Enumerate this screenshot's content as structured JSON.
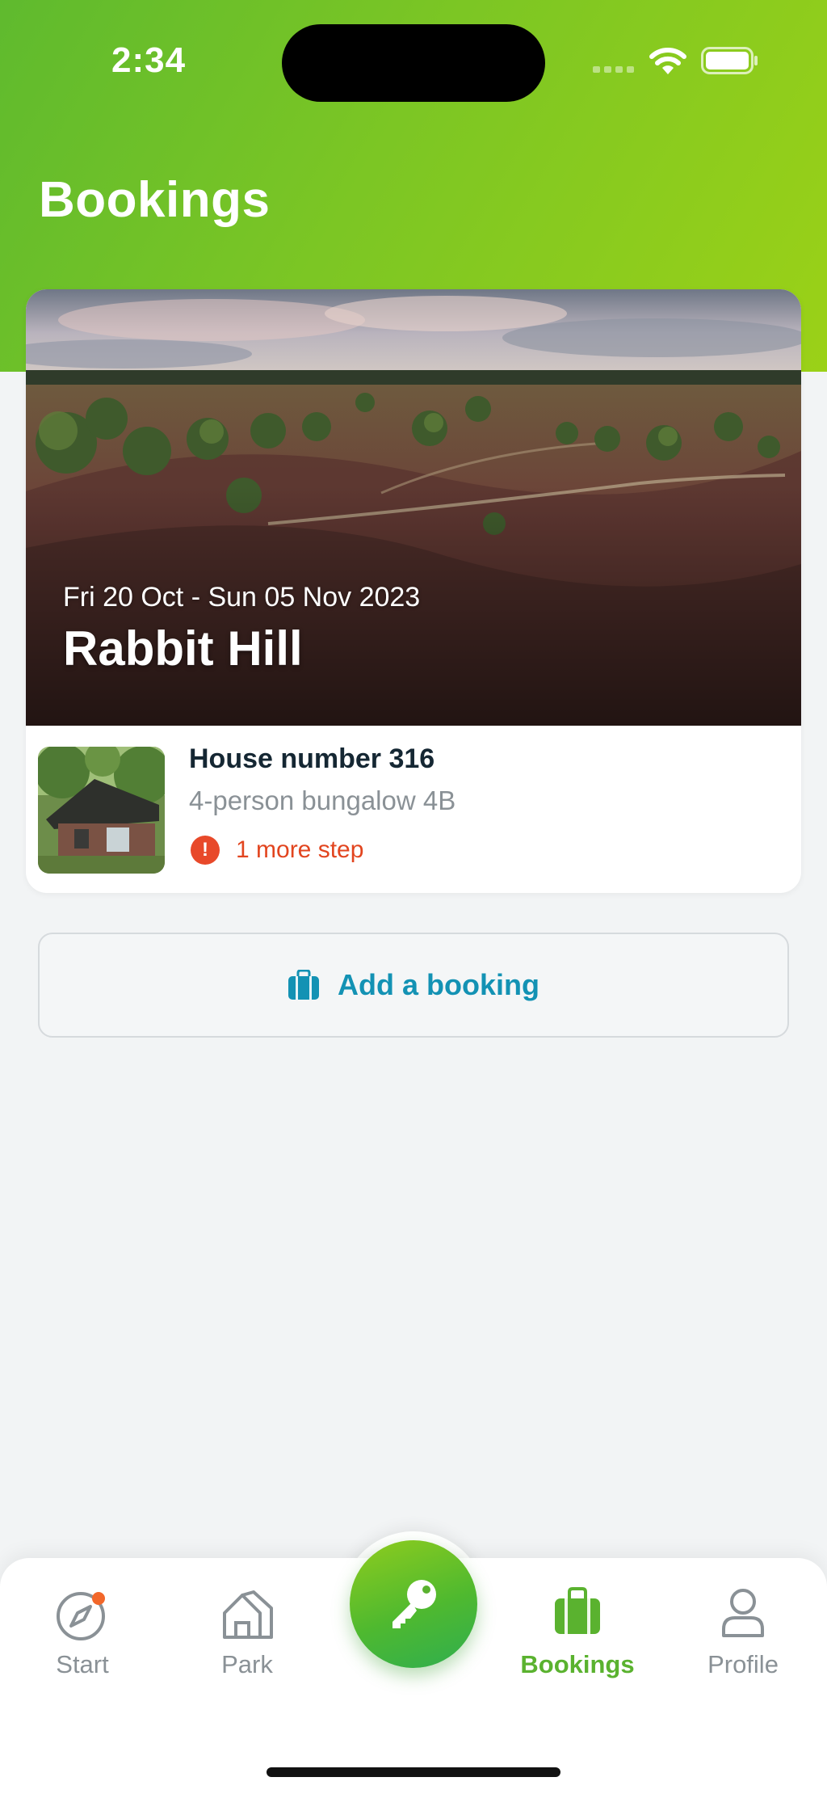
{
  "status_bar": {
    "time": "2:34"
  },
  "header": {
    "title": "Bookings"
  },
  "booking": {
    "dates": "Fri 20 Oct - Sun 05 Nov 2023",
    "park_name": "Rabbit Hill",
    "house_title": "House number 316",
    "house_type": "4-person bungalow 4B",
    "status_text": "1 more step",
    "status_icon": "exclamation-circle-icon"
  },
  "actions": {
    "add_booking_label": "Add a booking",
    "add_booking_icon": "suitcase-icon"
  },
  "tabbar": {
    "items": [
      {
        "label": "Start",
        "icon": "compass-icon",
        "has_notification": true
      },
      {
        "label": "Park",
        "icon": "house-icon"
      },
      {
        "label": "",
        "icon": "key-icon"
      },
      {
        "label": "Bookings",
        "icon": "suitcase-icon",
        "active": true
      },
      {
        "label": "Profile",
        "icon": "person-icon"
      }
    ]
  },
  "colors": {
    "brand_green": "#5ab22f",
    "header_gradient_start": "#5fba2e",
    "header_gradient_end": "#9bd117",
    "link_blue": "#1392b4",
    "alert_red": "#e8492a"
  }
}
